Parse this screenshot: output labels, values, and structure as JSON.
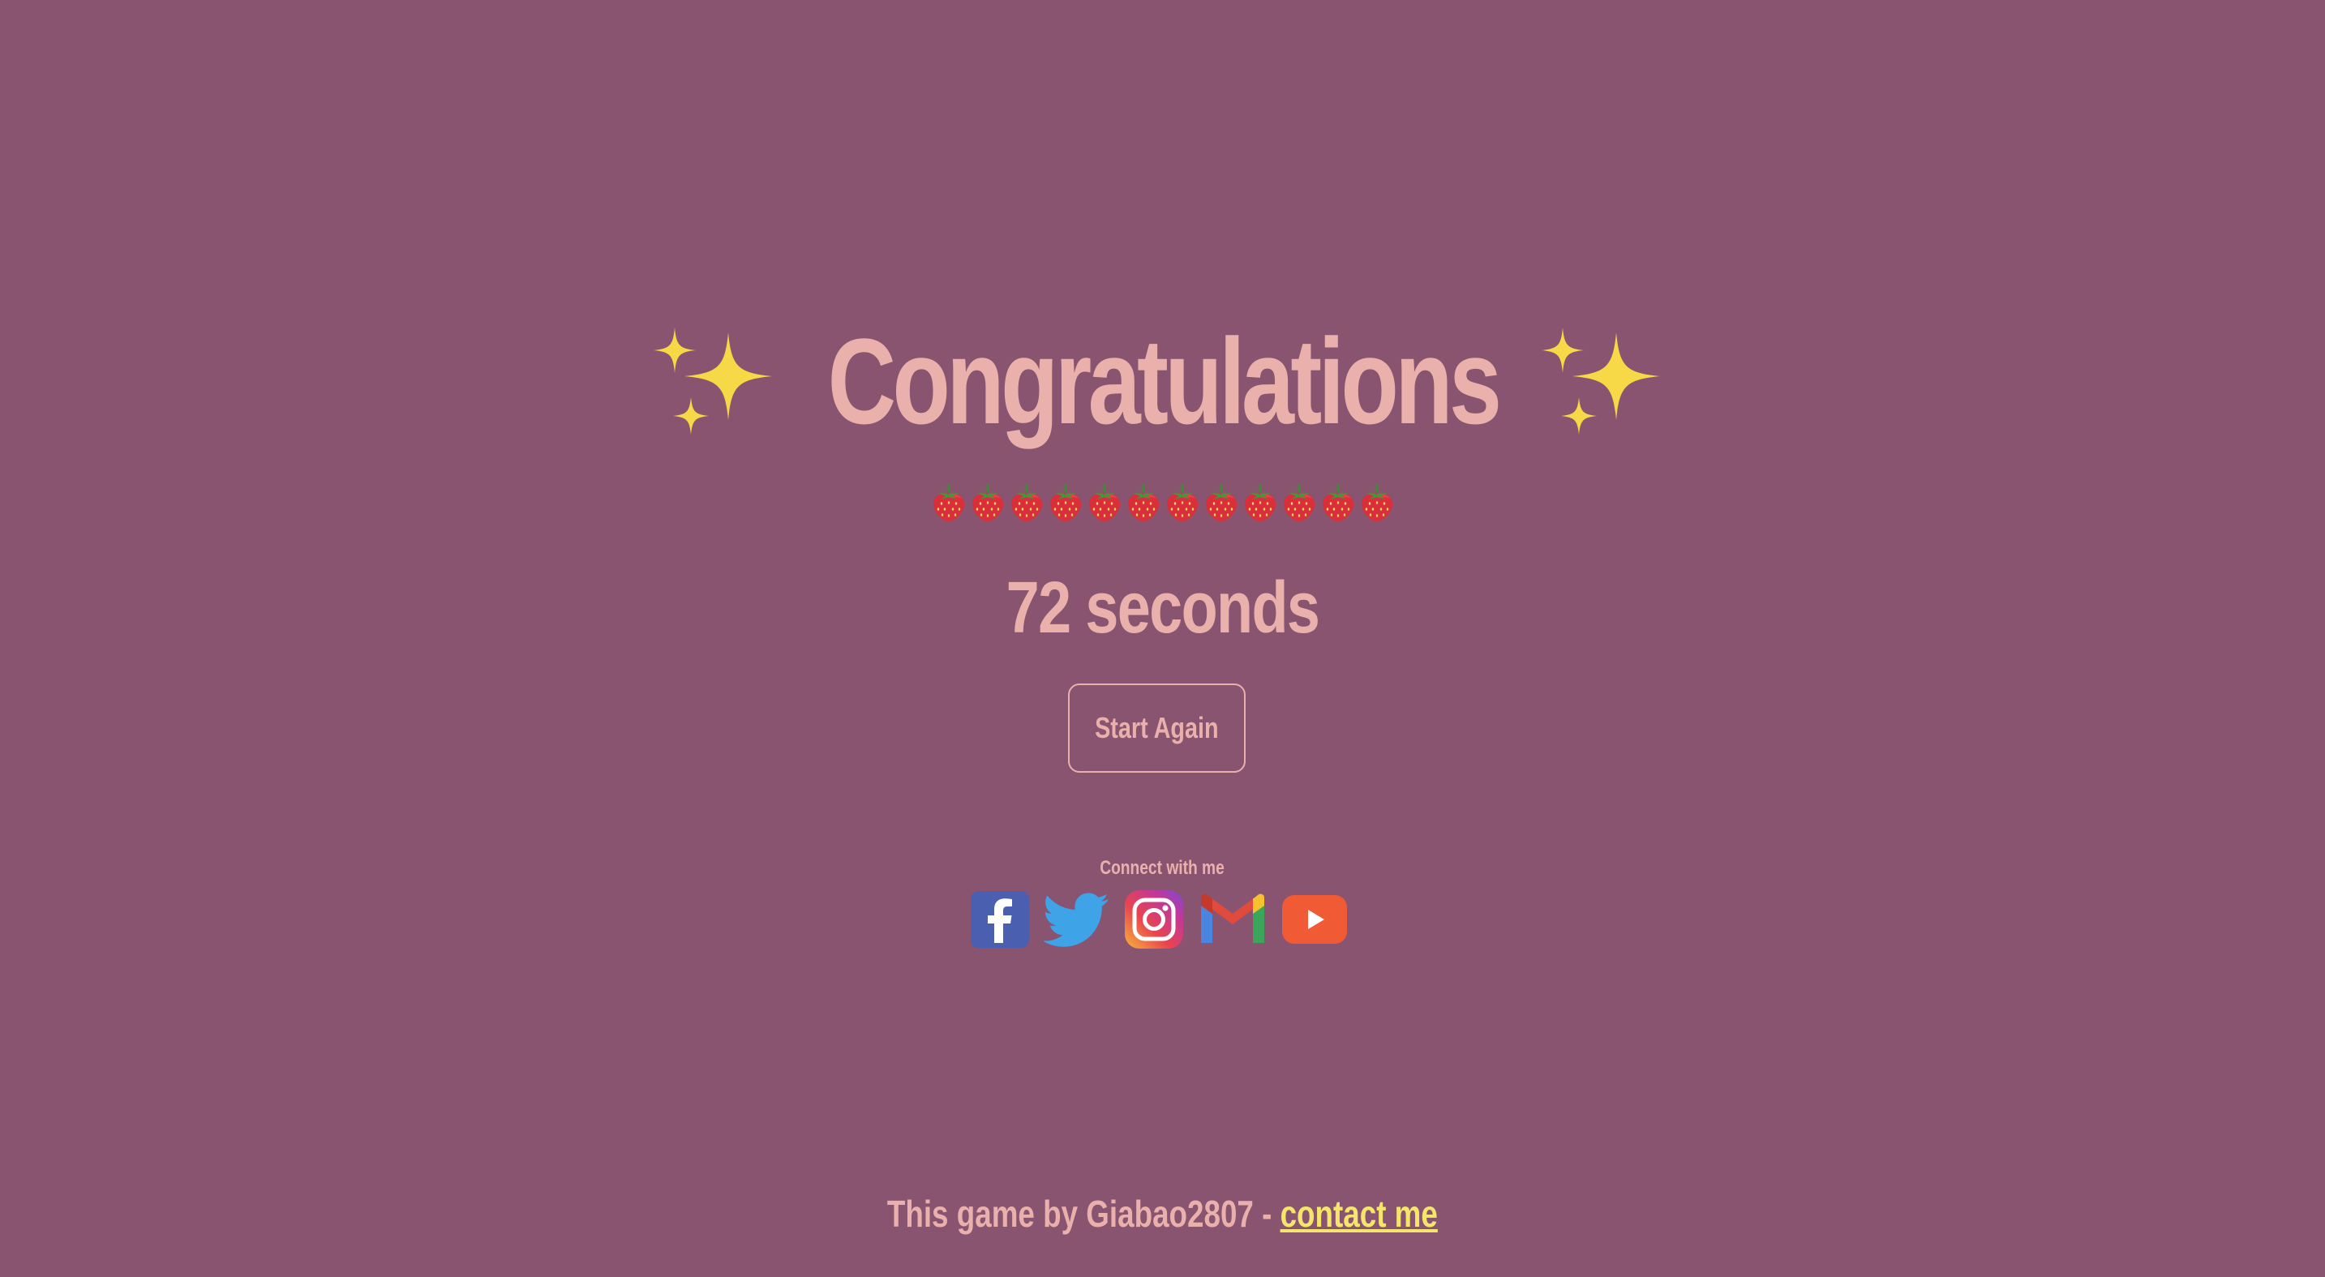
{
  "title": "Congratulations",
  "title_icon": "sparkles-icon",
  "strawberries": {
    "icon": "strawberry-icon",
    "count": 12
  },
  "result": {
    "time": "72 seconds"
  },
  "start_again_label": "Start Again",
  "connect": {
    "label": "Connect with me",
    "links": [
      {
        "name": "facebook-icon",
        "color": "#4a5fb0"
      },
      {
        "name": "twitter-icon",
        "color": "#3fa3e8"
      },
      {
        "name": "instagram-icon",
        "color": "#d8407a"
      },
      {
        "name": "gmail-icon",
        "color": "#e04b3c"
      },
      {
        "name": "youtube-icon",
        "color": "#f05a35"
      }
    ]
  },
  "footer": {
    "text": "This game by Giabao2807 - ",
    "link_label": "contact me",
    "link_color": "#f5e56b"
  },
  "colors": {
    "background": "#88546f",
    "text": "#eab0ac",
    "sparkle": "#f7d847"
  }
}
